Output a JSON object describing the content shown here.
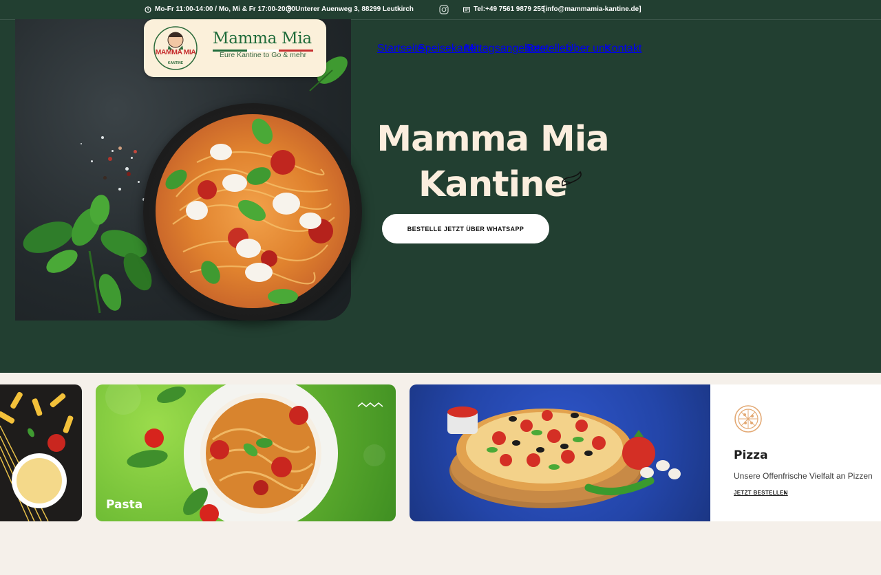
{
  "topbar": {
    "hours": "Mo-Fr 11:00-14:00 / Mo, Mi & Fr 17:00-20:30",
    "address": "Unterer Auenweg 3, 88299 Leutkirch",
    "phone": "Tel:+49 7561 9879 255",
    "email": "[info@mammamia-kantine.de]"
  },
  "logo": {
    "badge_text": "MAMMA MIA",
    "badge_sub": "KANTINE",
    "title": "Mamma Mia",
    "subtitle": "Eure Kantine to Go & mehr"
  },
  "nav": {
    "items": [
      "Startseite",
      "Speisekarte",
      "Mittagsangebote",
      "Bestellen",
      "Über uns",
      "Kontakt"
    ]
  },
  "hero": {
    "title_line1": "Mamma Mia",
    "title_line2": "Kantine",
    "cta": "BESTELLE JETZT ÜBER WHATSAPP"
  },
  "cards": {
    "pasta_label": "Pasta",
    "pizza": {
      "title": "Pizza",
      "description": "Unsere Offenfrische Vielfalt an Pizzen",
      "link": "JETZT BESTELLEN"
    }
  },
  "colors": {
    "hero_bg": "#223f31",
    "page_bg": "#f5f0ea",
    "accent_cream": "#fbeede",
    "logo_green": "#1f6b3a",
    "logo_red": "#c62f2f"
  }
}
